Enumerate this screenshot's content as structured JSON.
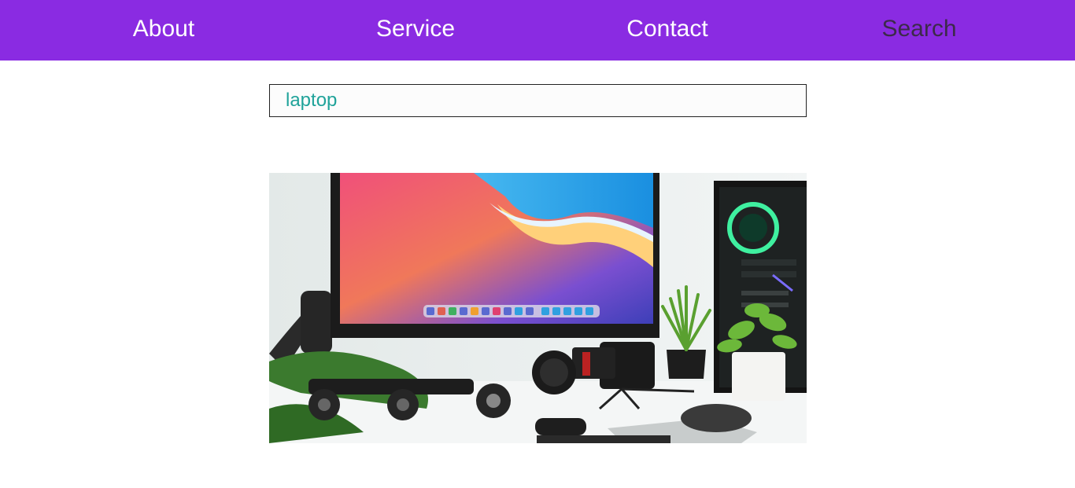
{
  "nav": {
    "items": [
      {
        "label": "About"
      },
      {
        "label": "Service"
      },
      {
        "label": "Contact"
      },
      {
        "label": "Search"
      }
    ]
  },
  "search": {
    "value": "laptop",
    "placeholder": ""
  },
  "colors": {
    "nav_background": "#8a2be2",
    "nav_text": "#ffffff",
    "nav_text_active": "#3c2a4a",
    "input_text": "#20a39a"
  },
  "result_image": {
    "alt": "desk-setup-photo"
  }
}
